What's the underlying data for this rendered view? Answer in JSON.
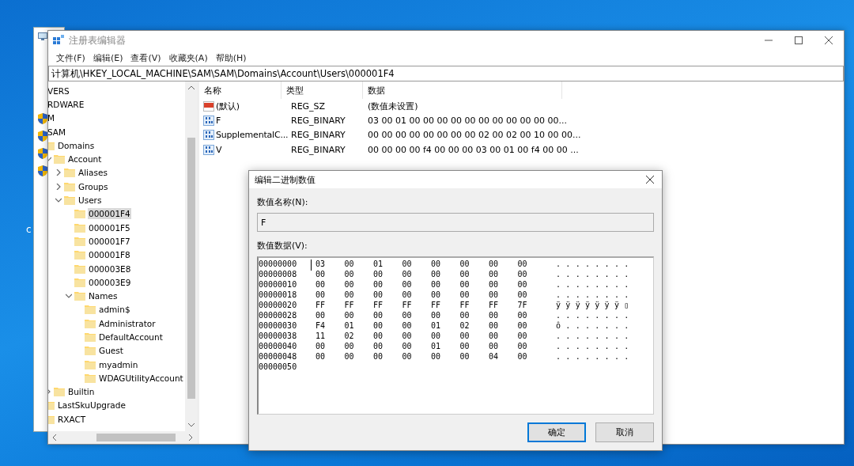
{
  "desktop": {
    "label": "c"
  },
  "window": {
    "title": "注册表编辑器"
  },
  "menu": [
    "文件(F)",
    "编辑(E)",
    "查看(V)",
    "收藏夹(A)",
    "帮助(H)"
  ],
  "address": "计算机\\HKEY_LOCAL_MACHINE\\SAM\\SAM\\Domains\\Account\\Users\\000001F4",
  "tree": [
    {
      "label": "VERS",
      "selected": false
    },
    {
      "label": "RDWARE",
      "selected": false
    },
    {
      "label": "M",
      "selected": false
    },
    {
      "label": "SAM",
      "selected": false,
      "children": [
        {
          "label": "Domains",
          "selected": false,
          "children": [
            {
              "label": "Account",
              "selected": false,
              "expanded": true,
              "children": [
                {
                  "label": "Aliases",
                  "selected": false,
                  "expanded": false
                },
                {
                  "label": "Groups",
                  "selected": false,
                  "expanded": false
                },
                {
                  "label": "Users",
                  "selected": false,
                  "expanded": true,
                  "children": [
                    {
                      "label": "000001F4",
                      "selected": true
                    },
                    {
                      "label": "000001F5",
                      "selected": false
                    },
                    {
                      "label": "000001F7",
                      "selected": false
                    },
                    {
                      "label": "000001F8",
                      "selected": false
                    },
                    {
                      "label": "000003E8",
                      "selected": false
                    },
                    {
                      "label": "000003E9",
                      "selected": false
                    },
                    {
                      "label": "Names",
                      "selected": false,
                      "expanded": true,
                      "children": [
                        {
                          "label": "admin$",
                          "selected": false
                        },
                        {
                          "label": "Administrator",
                          "selected": false
                        },
                        {
                          "label": "DefaultAccount",
                          "selected": false
                        },
                        {
                          "label": "Guest",
                          "selected": false
                        },
                        {
                          "label": "myadmin",
                          "selected": false
                        },
                        {
                          "label": "WDAGUtilityAccount",
                          "selected": false
                        }
                      ]
                    }
                  ]
                }
              ]
            },
            {
              "label": "Builtin",
              "selected": false,
              "expanded": false
            }
          ]
        },
        {
          "label": "LastSkuUpgrade",
          "selected": false
        },
        {
          "label": "RXACT",
          "selected": false
        }
      ]
    }
  ],
  "list": {
    "columns": [
      "名称",
      "类型",
      "数据"
    ],
    "rows": [
      {
        "name": "(默认)",
        "type": "REG_SZ",
        "data": "(数值未设置)",
        "kind": "string"
      },
      {
        "name": "F",
        "type": "REG_BINARY",
        "data": "03 00 01 00 00 00 00 00 00 00 00 00 00 00...",
        "kind": "binary"
      },
      {
        "name": "SupplementalC...",
        "type": "REG_BINARY",
        "data": "00 00 00 00 00 00 00 00 02 00 02 00 10 00 00...",
        "kind": "binary"
      },
      {
        "name": "V",
        "type": "REG_BINARY",
        "data": "00 00 00 00 f4 00 00 00 03 00 01 00 f4 00 00 ...",
        "kind": "binary"
      }
    ]
  },
  "dialog": {
    "title": "编辑二进制数值",
    "name_label": "数值名称(N):",
    "name_value": "F",
    "data_label": "数值数据(V):",
    "hex": [
      {
        "address": "00000000",
        "bytes": [
          "03",
          "00",
          "01",
          "00",
          "00",
          "00",
          "00",
          "00"
        ],
        "ascii": "........"
      },
      {
        "address": "00000008",
        "bytes": [
          "00",
          "00",
          "00",
          "00",
          "00",
          "00",
          "00",
          "00"
        ],
        "ascii": "........"
      },
      {
        "address": "00000010",
        "bytes": [
          "00",
          "00",
          "00",
          "00",
          "00",
          "00",
          "00",
          "00"
        ],
        "ascii": "........"
      },
      {
        "address": "00000018",
        "bytes": [
          "00",
          "00",
          "00",
          "00",
          "00",
          "00",
          "00",
          "00"
        ],
        "ascii": "........"
      },
      {
        "address": "00000020",
        "bytes": [
          "FF",
          "FF",
          "FF",
          "FF",
          "FF",
          "FF",
          "FF",
          "7F"
        ],
        "ascii": "ÿÿÿÿÿÿÿ▯"
      },
      {
        "address": "00000028",
        "bytes": [
          "00",
          "00",
          "00",
          "00",
          "00",
          "00",
          "00",
          "00"
        ],
        "ascii": "........"
      },
      {
        "address": "00000030",
        "bytes": [
          "F4",
          "01",
          "00",
          "00",
          "01",
          "02",
          "00",
          "00"
        ],
        "ascii": "ô......."
      },
      {
        "address": "00000038",
        "bytes": [
          "11",
          "02",
          "00",
          "00",
          "00",
          "00",
          "00",
          "00"
        ],
        "ascii": "........"
      },
      {
        "address": "00000040",
        "bytes": [
          "00",
          "00",
          "00",
          "00",
          "01",
          "00",
          "00",
          "00"
        ],
        "ascii": "........"
      },
      {
        "address": "00000048",
        "bytes": [
          "00",
          "00",
          "00",
          "00",
          "00",
          "00",
          "04",
          "00"
        ],
        "ascii": "........"
      },
      {
        "address": "00000050"
      }
    ],
    "buttons": [
      {
        "label": "确定",
        "default": true
      },
      {
        "label": "取消",
        "default": false
      }
    ]
  }
}
